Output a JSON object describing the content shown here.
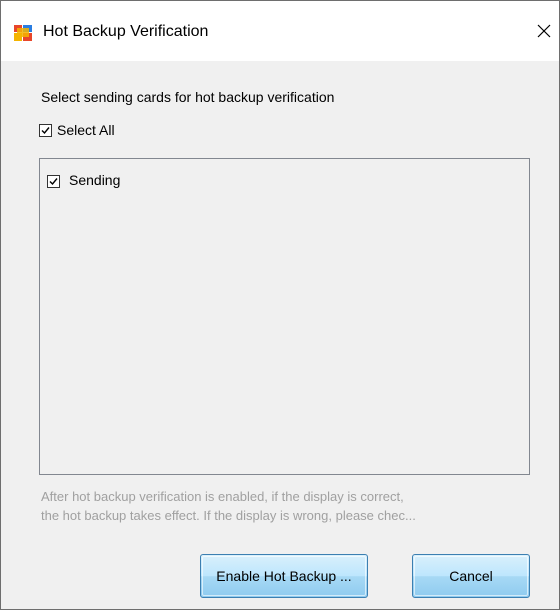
{
  "window": {
    "title": "Hot Backup Verification",
    "icon": "app-icon",
    "close_glyph": "✕"
  },
  "main": {
    "instruction": "Select sending cards for hot backup verification",
    "select_all": {
      "label": "Select All",
      "checked": true
    },
    "cards": [
      {
        "label": "Sending",
        "checked": true
      }
    ],
    "hint_lines": [
      "After hot backup verification is enabled, if the display is correct,",
      "the hot backup takes effect. If the display is wrong, please chec..."
    ]
  },
  "buttons": {
    "enable_label": "Enable Hot Backup ...",
    "cancel_label": "Cancel"
  },
  "colors": {
    "button_border": "#3c7fb1",
    "hint_text": "#a0a0a0",
    "dialog_bg": "#f0f0f0"
  }
}
